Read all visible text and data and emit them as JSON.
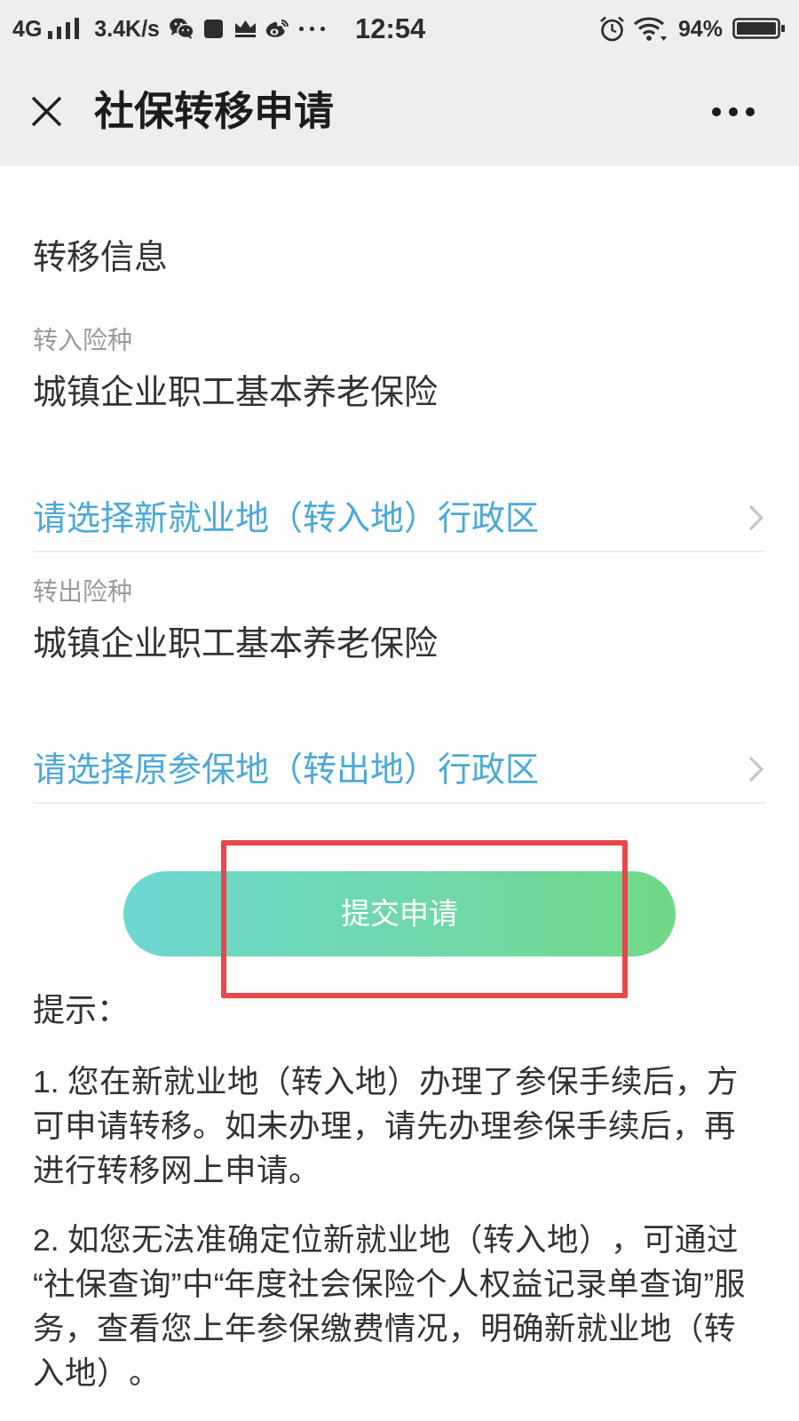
{
  "status_bar": {
    "network": "4G",
    "speed": "3.4K/s",
    "time": "12:54",
    "battery": "94%"
  },
  "header": {
    "title": "社保转移申请"
  },
  "section": {
    "title": "转移信息"
  },
  "transfers": [
    {
      "label": "转入险种",
      "value": "城镇企业职工基本养老保险",
      "prompt": "请选择新就业地（转入地）行政区"
    },
    {
      "label": "转出险种",
      "value": "城镇企业职工基本养老保险",
      "prompt": "请选择原参保地（转出地）行政区"
    }
  ],
  "submit_button": {
    "label": "提交申请",
    "highlighted": true
  },
  "tips": {
    "title": "提示：",
    "items": [
      "1. 您在新就业地（转入地）办理了参保手续后，方可申请转移。如未办理，请先办理参保手续后，再进行转移网上申请。",
      "2. 如您无法准确定位新就业地（转入地），可通过“社保查询”中“年度社会保险个人权益记录单查询”服务，查看您上年参保缴费情况，明确新就业地（转入地）。"
    ]
  }
}
